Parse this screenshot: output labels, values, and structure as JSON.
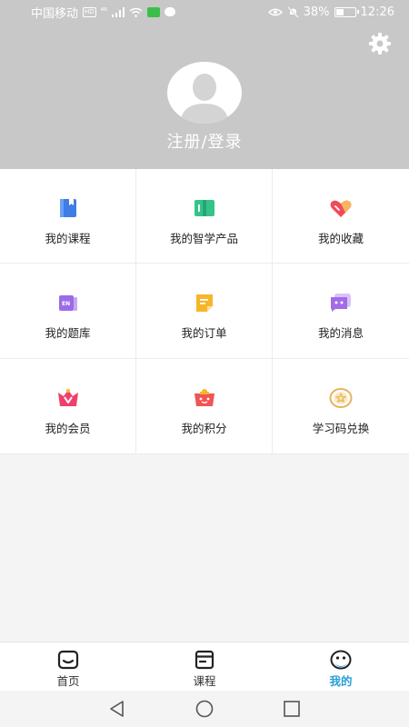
{
  "status_bar": {
    "carrier": "中国移动",
    "hd": "HD",
    "network": "⁴⁶",
    "battery_percent": "38%",
    "time": "12:26"
  },
  "header": {
    "login_label": "注册/登录"
  },
  "menu": [
    {
      "label": "我的课程",
      "icon": "course-book-icon",
      "color": "#3f7de6"
    },
    {
      "label": "我的智学产品",
      "icon": "open-book-icon",
      "color": "#35c38a"
    },
    {
      "label": "我的收藏",
      "icon": "heart-icon",
      "color": "#f04b5a"
    },
    {
      "label": "我的题库",
      "icon": "question-bank-icon",
      "color": "#9b6ce8"
    },
    {
      "label": "我的订单",
      "icon": "order-icon",
      "color": "#f6b62a"
    },
    {
      "label": "我的消息",
      "icon": "message-icon",
      "color": "#a36be8"
    },
    {
      "label": "我的会员",
      "icon": "vip-crown-icon",
      "color": "#ef3f6d"
    },
    {
      "label": "我的积分",
      "icon": "points-bag-icon",
      "color": "#f05454"
    },
    {
      "label": "学习码兑换",
      "icon": "star-coupon-icon",
      "color": "#e9b35a"
    }
  ],
  "bottom_nav": [
    {
      "label": "首页",
      "icon": "home-icon",
      "active": false
    },
    {
      "label": "课程",
      "icon": "course-icon",
      "active": false
    },
    {
      "label": "我的",
      "icon": "profile-face-icon",
      "active": true
    }
  ],
  "colors": {
    "header_bg": "#c8c8c8",
    "active_tab": "#2aa0d9"
  }
}
